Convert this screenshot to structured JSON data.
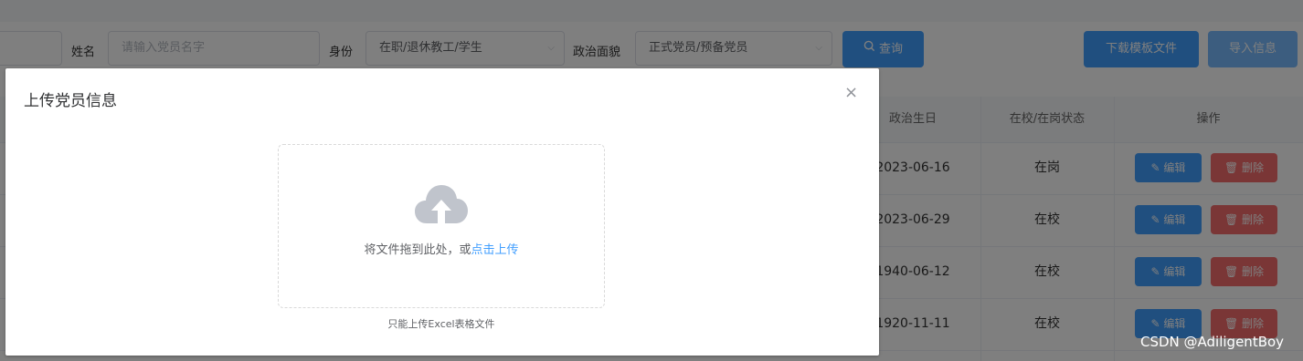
{
  "filters": {
    "name_label": "姓名",
    "name_placeholder": "请输入党员名字",
    "identity_label": "身份",
    "identity_value": "在职/退休教工/学生",
    "politics_label": "政治面貌",
    "politics_value": "正式党员/预备党员",
    "query_button": "查询",
    "download_template_button": "下载模板文件",
    "import_button": "导入信息"
  },
  "table": {
    "columns": [
      "政治生日",
      "在校/在岗状态",
      "操作"
    ],
    "rows": [
      {
        "date": "2023-06-16",
        "status": "在岗"
      },
      {
        "date": "2023-06-29",
        "status": "在校"
      },
      {
        "date": "1940-06-12",
        "status": "在校"
      },
      {
        "date": "1920-11-11",
        "status": "在校"
      }
    ],
    "edit_label": "编辑",
    "delete_label": "删除"
  },
  "dialog": {
    "title": "上传党员信息",
    "close_symbol": "×",
    "upload_text": "将文件拖到此处，或",
    "upload_link": "点击上传",
    "tip": "只能上传Excel表格文件"
  },
  "watermark": "CSDN @AdiligentBoy",
  "colors": {
    "primary": "#409eff",
    "danger": "#f56c6c",
    "overlay": "rgba(0,0,0,0.5)"
  }
}
